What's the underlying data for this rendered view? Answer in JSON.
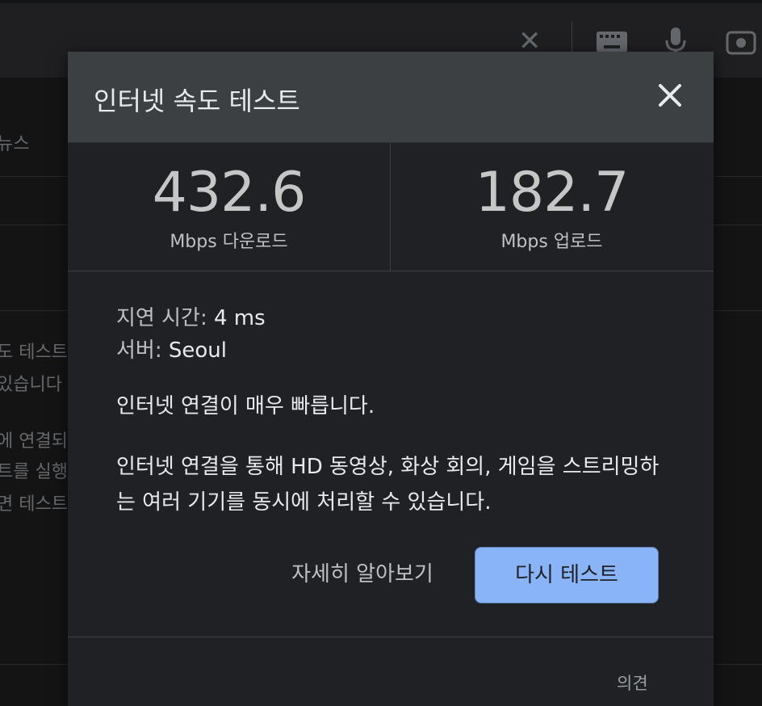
{
  "background": {
    "nav_partial": "뉴스",
    "snippet_lines": [
      "도 테스트",
      "있습니다",
      "에 연결되",
      "트를 실행",
      "면 테스트"
    ],
    "icons": [
      "close-icon",
      "keyboard-icon",
      "mic-icon",
      "camera-search-icon"
    ]
  },
  "dialog": {
    "title": "인터넷 속도 테스트",
    "download": {
      "value": "432.6",
      "label": "Mbps 다운로드"
    },
    "upload": {
      "value": "182.7",
      "label": "Mbps 업로드"
    },
    "latency_label": "지연 시간:",
    "latency_value": "4 ms",
    "server_label": "서버:",
    "server_value": "Seoul",
    "summary": "인터넷 연결이 매우 빠릅니다.",
    "detail_line1": "인터넷 연결을 통해 HD 동영상, 화상 회의, 게임을 스트리밍하",
    "detail_line2": "는 여러 기기를 동시에 처리할 수 있습니다.",
    "learn_more": "자세히 알아보기",
    "retest": "다시 테스트",
    "feedback": "의견"
  },
  "colors": {
    "accent": "#8ab4f8",
    "dialog_bg": "#202124",
    "header_bg": "#3c4043"
  }
}
